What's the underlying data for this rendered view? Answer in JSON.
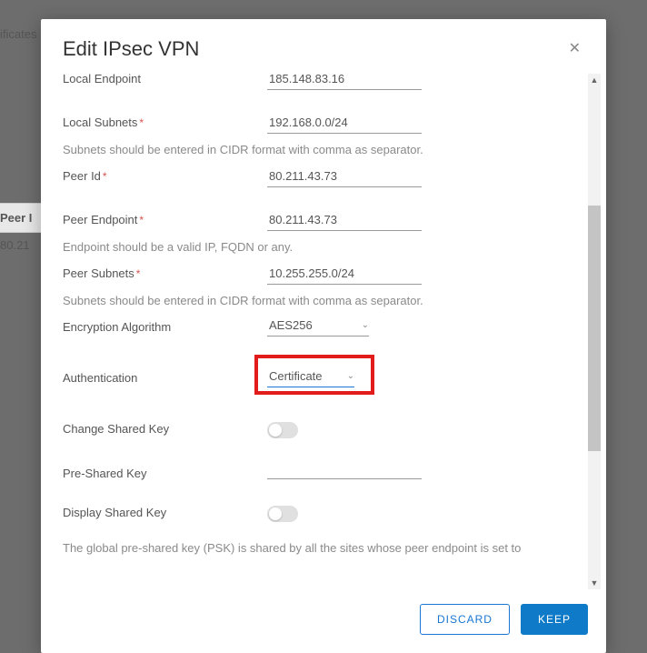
{
  "bg": {
    "ificates": "ificates",
    "peer": "Peer I",
    "ip": "80.21"
  },
  "modal": {
    "title": "Edit IPsec VPN",
    "footer": {
      "discard": "DISCARD",
      "keep": "KEEP"
    }
  },
  "form": {
    "local_endpoint": {
      "label": "Local Endpoint",
      "value": "185.148.83.16"
    },
    "local_subnets": {
      "label": "Local Subnets",
      "value": "192.168.0.0/24",
      "helper": "Subnets should be entered in CIDR format with comma as separator."
    },
    "peer_id": {
      "label": "Peer Id",
      "value": "80.211.43.73"
    },
    "peer_endpoint": {
      "label": "Peer Endpoint",
      "value": "80.211.43.73",
      "helper": "Endpoint should be a valid IP, FQDN or any."
    },
    "peer_subnets": {
      "label": "Peer Subnets",
      "value": "10.255.255.0/24",
      "helper": "Subnets should be entered in CIDR format with comma as separator."
    },
    "encryption": {
      "label": "Encryption Algorithm",
      "value": "AES256"
    },
    "authentication": {
      "label": "Authentication",
      "value": "Certificate"
    },
    "change_shared_key": {
      "label": "Change Shared Key"
    },
    "pre_shared_key": {
      "label": "Pre-Shared Key"
    },
    "display_shared_key": {
      "label": "Display Shared Key"
    },
    "psk_note": "The global pre-shared key (PSK) is shared by all the sites whose peer endpoint is set to"
  }
}
